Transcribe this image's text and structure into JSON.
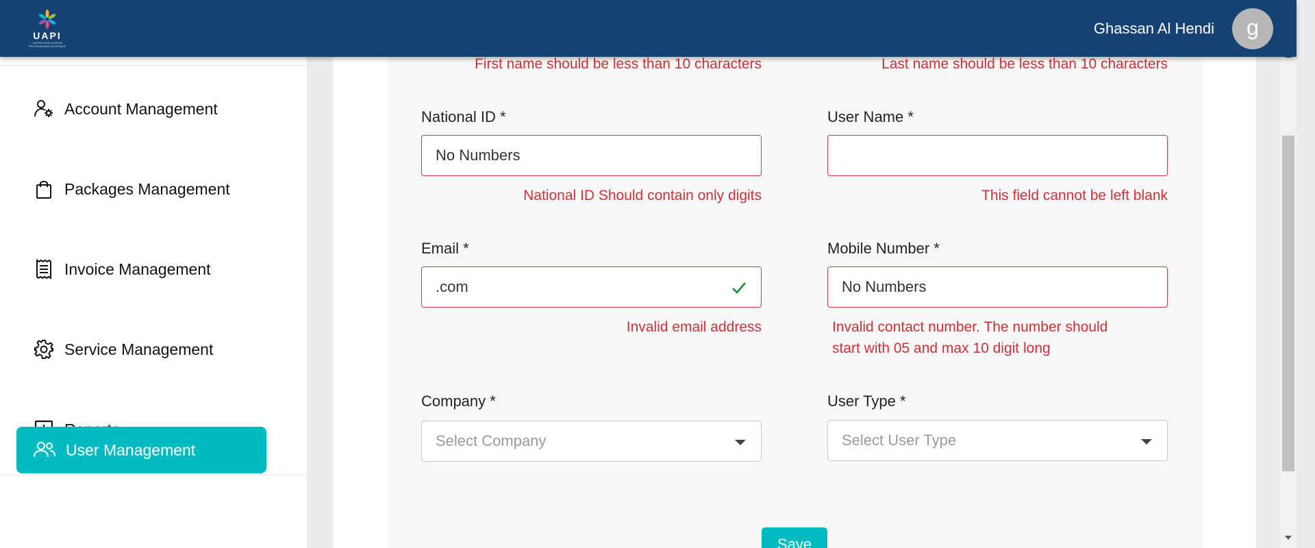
{
  "header": {
    "logo_text": "UAPI",
    "logo_subtitle": "UNIFIED APPLICATION PROGRAMMING INTERFACE",
    "user_name": "Ghassan Al Hendi",
    "avatar_letter": "g"
  },
  "sidebar": {
    "items": [
      {
        "label": "Account Management",
        "icon": "user-gear-icon"
      },
      {
        "label": "Packages Management",
        "icon": "shopping-bag-icon"
      },
      {
        "label": "Invoice Management",
        "icon": "receipt-icon"
      },
      {
        "label": "Service Management",
        "icon": "gear-icon"
      },
      {
        "label": "Reports",
        "icon": "bar-chart-icon"
      },
      {
        "label": "User Management",
        "icon": "users-icon",
        "active": true
      }
    ]
  },
  "form": {
    "first_name_error": "First name should be less than 10 characters",
    "last_name_error": "Last name should be less than 10 characters",
    "national_id": {
      "label": "National ID *",
      "value": "No Numbers",
      "error": "National ID Should contain only digits"
    },
    "user_name": {
      "label": "User Name *",
      "value": "",
      "error": "This field cannot be left blank"
    },
    "email": {
      "label": "Email *",
      "value": ".com",
      "error": "Invalid email address"
    },
    "mobile": {
      "label": "Mobile Number *",
      "value": "No Numbers",
      "error_line1": "Invalid contact number. The number should",
      "error_line2": "start with 05 and max 10 digit long"
    },
    "company": {
      "label": "Company *",
      "placeholder": "Select Company"
    },
    "user_type": {
      "label": "User Type *",
      "placeholder": "Select User Type"
    },
    "save_label": "Save"
  },
  "colors": {
    "header_bg": "#154272",
    "accent": "#00bcc2",
    "error": "#cf3037",
    "success": "#1e8a2e"
  }
}
